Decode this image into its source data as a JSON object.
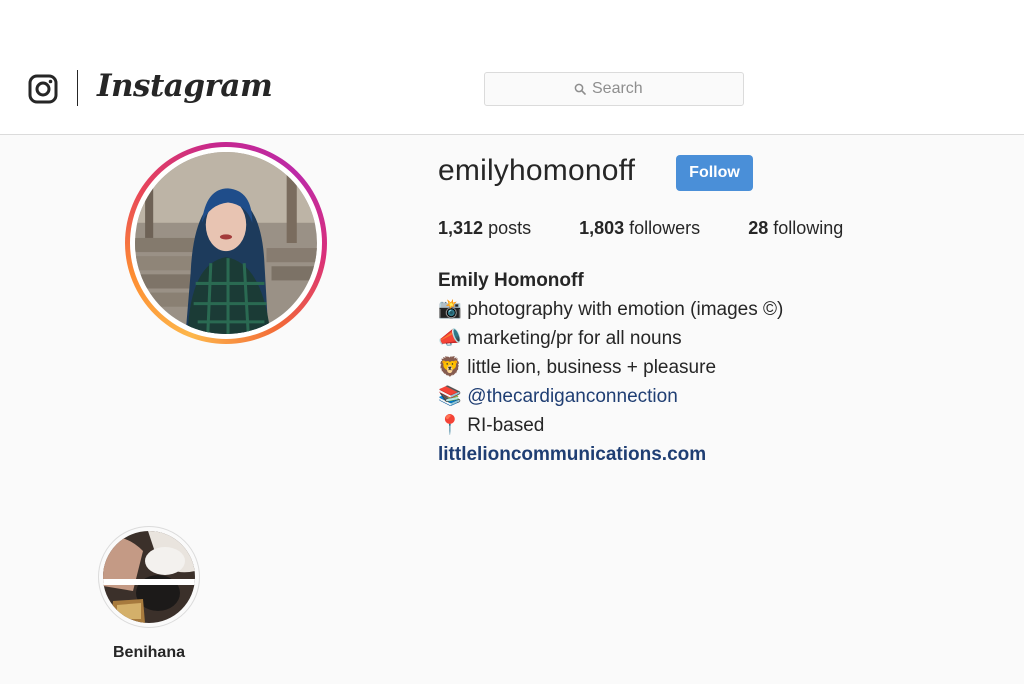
{
  "header": {
    "wordmark": "Instagram",
    "search": {
      "placeholder": "Search"
    }
  },
  "profile": {
    "username": "emilyhomonoff",
    "follow_label": "Follow",
    "stats": [
      {
        "value": "1,312",
        "label": "posts"
      },
      {
        "value": "1,803",
        "label": "followers"
      },
      {
        "value": "28",
        "label": "following"
      }
    ],
    "bio": {
      "full_name": "Emily Homonoff",
      "lines": [
        {
          "emoji": "📸",
          "text": "photography with emotion (images ©)"
        },
        {
          "emoji": "📣",
          "text": "marketing/pr for all nouns"
        },
        {
          "emoji": "🦁",
          "text": "little lion, business + pleasure"
        },
        {
          "emoji": "📚",
          "text": "@thecardiganconnection"
        },
        {
          "emoji": "📍",
          "text": "RI-based"
        }
      ],
      "website": "littlelioncommunications.com"
    }
  },
  "highlights": [
    {
      "label": "Benihana"
    }
  ],
  "colors": {
    "follow_button": "#4a8fd8",
    "link": "#1f3e73"
  }
}
